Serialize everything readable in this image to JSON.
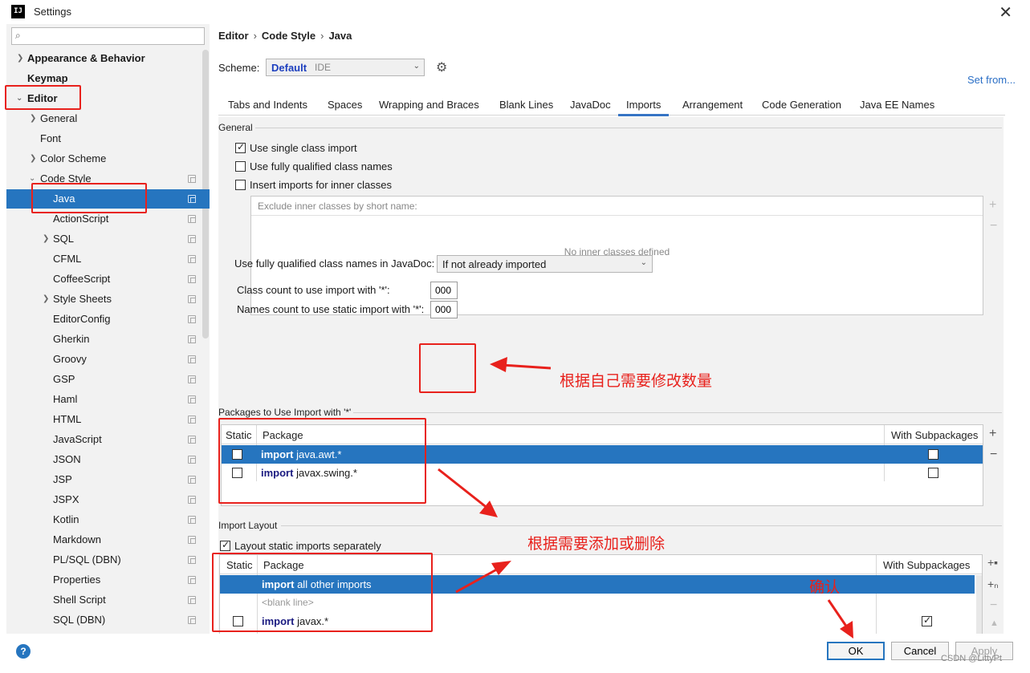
{
  "window": {
    "title": "Settings",
    "app_icon": "IJ"
  },
  "search": {
    "placeholder": "",
    "value": ""
  },
  "sidebar": {
    "items": [
      {
        "label": "Appearance & Behavior"
      },
      {
        "label": "Keymap"
      },
      {
        "label": "Editor"
      },
      {
        "label": "General"
      },
      {
        "label": "Font"
      },
      {
        "label": "Color Scheme"
      },
      {
        "label": "Code Style"
      },
      {
        "label": "Java"
      },
      {
        "label": "ActionScript"
      },
      {
        "label": "SQL"
      },
      {
        "label": "CFML"
      },
      {
        "label": "CoffeeScript"
      },
      {
        "label": "Style Sheets"
      },
      {
        "label": "EditorConfig"
      },
      {
        "label": "Gherkin"
      },
      {
        "label": "Groovy"
      },
      {
        "label": "GSP"
      },
      {
        "label": "Haml"
      },
      {
        "label": "HTML"
      },
      {
        "label": "JavaScript"
      },
      {
        "label": "JSON"
      },
      {
        "label": "JSP"
      },
      {
        "label": "JSPX"
      },
      {
        "label": "Kotlin"
      },
      {
        "label": "Markdown"
      },
      {
        "label": "PL/SQL (DBN)"
      },
      {
        "label": "Properties"
      },
      {
        "label": "Shell Script"
      },
      {
        "label": "SQL (DBN)"
      }
    ]
  },
  "breadcrumb": {
    "part1": "Editor",
    "part2": "Code Style",
    "part3": "Java",
    "sep": "›"
  },
  "scheme": {
    "label": "Scheme:",
    "name": "Default",
    "tag": "IDE"
  },
  "set_from": "Set from...",
  "tabs": [
    {
      "label": "Tabs and Indents"
    },
    {
      "label": "Spaces"
    },
    {
      "label": "Wrapping and Braces"
    },
    {
      "label": "Blank Lines"
    },
    {
      "label": "JavaDoc"
    },
    {
      "label": "Imports"
    },
    {
      "label": "Arrangement"
    },
    {
      "label": "Code Generation"
    },
    {
      "label": "Java EE Names"
    }
  ],
  "general": {
    "title": "General",
    "use_single_class_import": "Use single class import",
    "use_fully_qualified": "Use fully qualified class names",
    "insert_imports_inner": "Insert imports for inner classes",
    "exclude_header": "Exclude inner classes by short name:",
    "exclude_empty": "No inner classes defined",
    "javadoc_label": "Use fully qualified class names in JavaDoc:",
    "javadoc_value": "If not already imported",
    "class_count_label": "Class count to use import with '*':",
    "class_count_value": "000",
    "names_count_label": "Names count to use static import with '*':",
    "names_count_value": "000"
  },
  "packages": {
    "title": "Packages to Use Import with '*'",
    "col_static": "Static",
    "col_package": "Package",
    "col_sub": "With Subpackages",
    "rows": [
      {
        "kw": "import",
        "pkg": "java.awt.*"
      },
      {
        "kw": "import",
        "pkg": "javax.swing.*"
      }
    ]
  },
  "layout": {
    "title": "Import Layout",
    "layout_static_separately": "Layout static imports separately",
    "col_static": "Static",
    "col_package": "Package",
    "col_sub": "With Subpackages",
    "rows": [
      {
        "kw": "import",
        "pkg": "all other imports"
      },
      {
        "blank": "<blank line>"
      },
      {
        "kw": "import",
        "pkg": "javax.*"
      }
    ]
  },
  "buttons": {
    "ok": "OK",
    "cancel": "Cancel",
    "apply": "Apply"
  },
  "help": "?",
  "annotations": {
    "modify_count": "根据自己需要修改数量",
    "add_remove": "根据需要添加或删除",
    "confirm": "确认"
  },
  "watermark": "CSDN @LittyPt",
  "colors": {
    "accent": "#2675bf",
    "annotation": "#e8211c",
    "scheme_name": "#1d3fbf"
  }
}
